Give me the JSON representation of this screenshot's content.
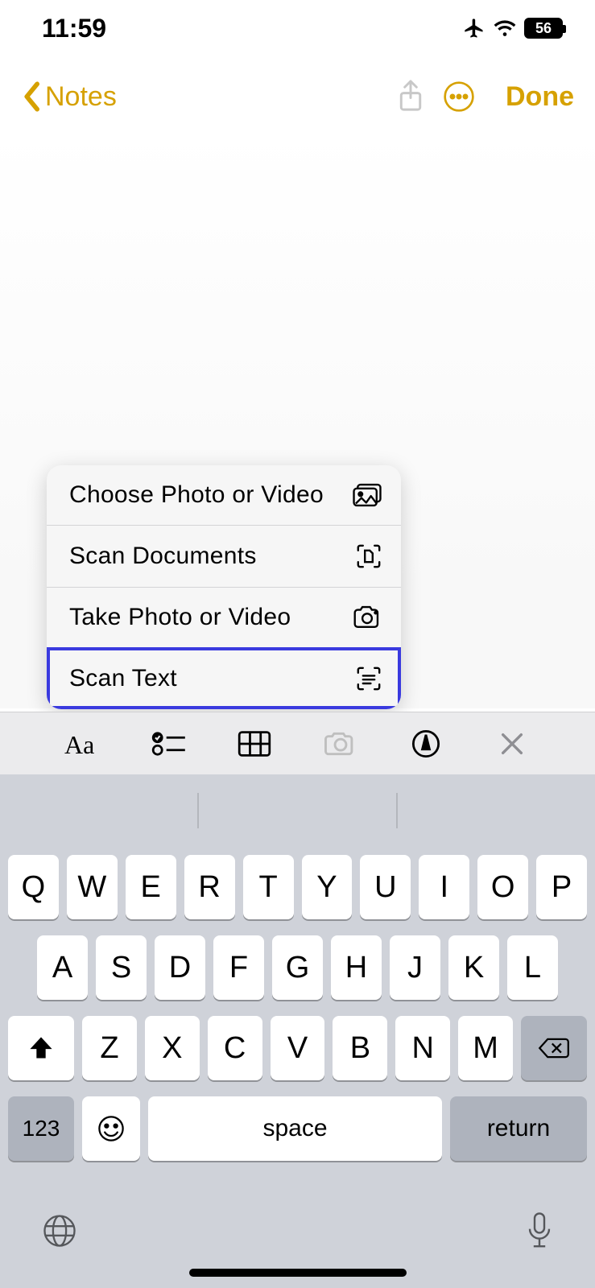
{
  "status": {
    "time": "11:59",
    "battery": "56"
  },
  "nav": {
    "back_label": "Notes",
    "done_label": "Done"
  },
  "popover": {
    "items": [
      {
        "label": "Choose Photo or Video",
        "icon": "photo-library-icon",
        "highlight": false
      },
      {
        "label": "Scan Documents",
        "icon": "scan-document-icon",
        "highlight": false
      },
      {
        "label": "Take Photo or Video",
        "icon": "camera-icon",
        "highlight": false
      },
      {
        "label": "Scan Text",
        "icon": "scan-text-icon",
        "highlight": true
      }
    ]
  },
  "format_bar": {
    "items": [
      "text-style",
      "checklist",
      "table",
      "camera-attach",
      "markup",
      "close-format"
    ]
  },
  "keyboard": {
    "row1": [
      "Q",
      "W",
      "E",
      "R",
      "T",
      "Y",
      "U",
      "I",
      "O",
      "P"
    ],
    "row2": [
      "A",
      "S",
      "D",
      "F",
      "G",
      "H",
      "J",
      "K",
      "L"
    ],
    "row3": [
      "Z",
      "X",
      "C",
      "V",
      "B",
      "N",
      "M"
    ],
    "numbers_label": "123",
    "space_label": "space",
    "return_label": "return"
  }
}
